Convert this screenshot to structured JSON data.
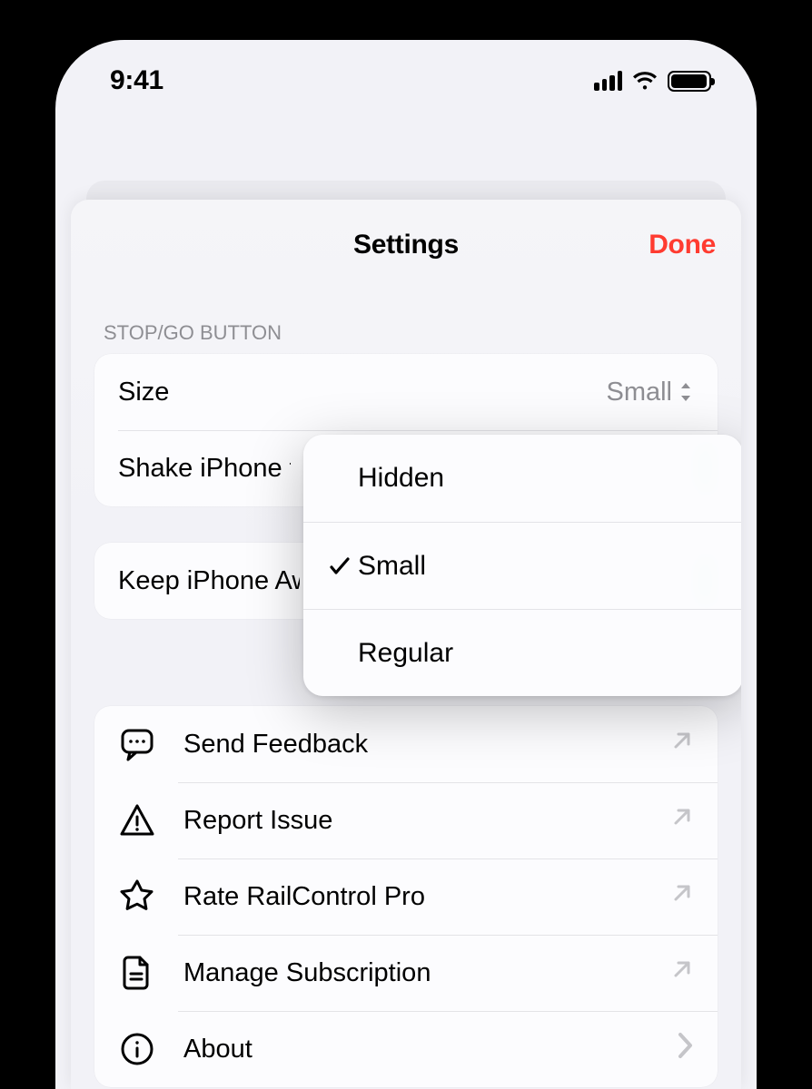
{
  "status": {
    "time": "9:41"
  },
  "header": {
    "title": "Settings",
    "done": "Done"
  },
  "section1": {
    "header": "STOP/GO BUTTON",
    "sizeLabel": "Size",
    "sizeValue": "Small",
    "shakeLabel": "Shake iPhone to Stop",
    "keepAwakeLabel": "Keep iPhone Awake"
  },
  "sizeMenu": {
    "options": [
      "Hidden",
      "Small",
      "Regular"
    ],
    "selected": "Small"
  },
  "links": {
    "feedback": "Send Feedback",
    "report": "Report Issue",
    "rate": "Rate RailControl Pro",
    "subscription": "Manage Subscription",
    "about": "About"
  }
}
